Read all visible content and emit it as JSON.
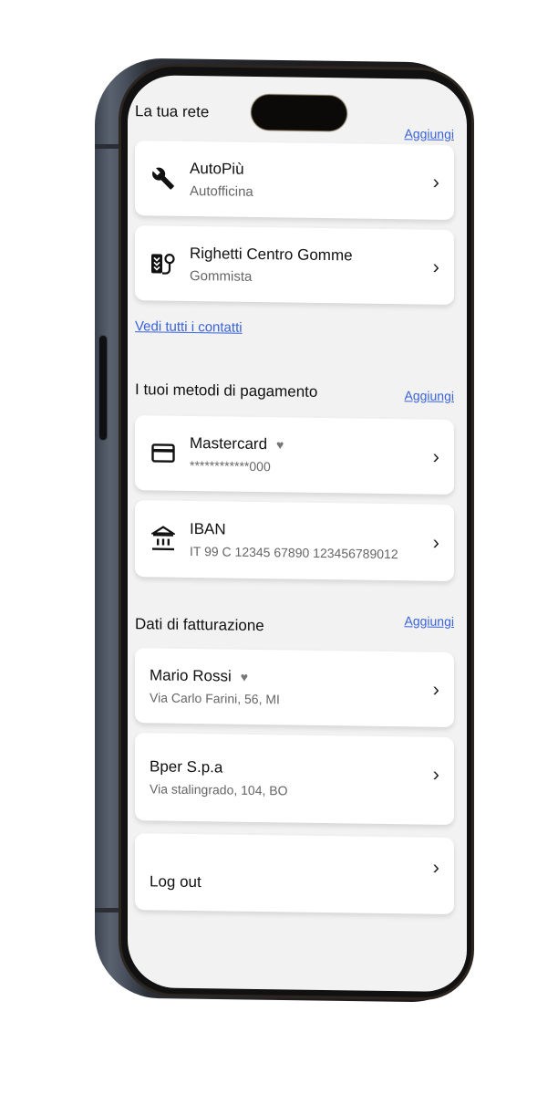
{
  "network": {
    "title": "La tua rete",
    "add_label": "Aggiungi",
    "contacts": [
      {
        "name": "AutoPiù",
        "type": "Autofficina",
        "icon": "wrench-icon"
      },
      {
        "name": "Righetti Centro Gomme",
        "type": "Gommista",
        "icon": "tire-pressure-icon"
      }
    ],
    "see_all_label": "Vedi tutti i contatti"
  },
  "payments": {
    "title": "I tuoi metodi di pagamento",
    "add_label": "Aggiungi",
    "methods": [
      {
        "name": "Mastercard",
        "detail": "************000",
        "favorite": true,
        "icon": "credit-card-icon"
      },
      {
        "name": "IBAN",
        "detail": "IT 99 C 12345 67890 123456789012",
        "favorite": false,
        "icon": "bank-icon"
      }
    ]
  },
  "billing": {
    "title": "Dati di fatturazione",
    "add_label": "Aggiungi",
    "entries": [
      {
        "name": "Mario Rossi",
        "address": "Via Carlo Farini, 56, MI",
        "favorite": true
      },
      {
        "name": "Bper S.p.a",
        "address": "Via stalingrado, 104, BO",
        "favorite": false
      }
    ]
  },
  "logout": {
    "label": "Log out"
  },
  "icons": {
    "heart": "♥",
    "chevron": "›"
  },
  "colors": {
    "link": "#3a63d8",
    "background": "#f2f2f2",
    "card": "#ffffff"
  }
}
